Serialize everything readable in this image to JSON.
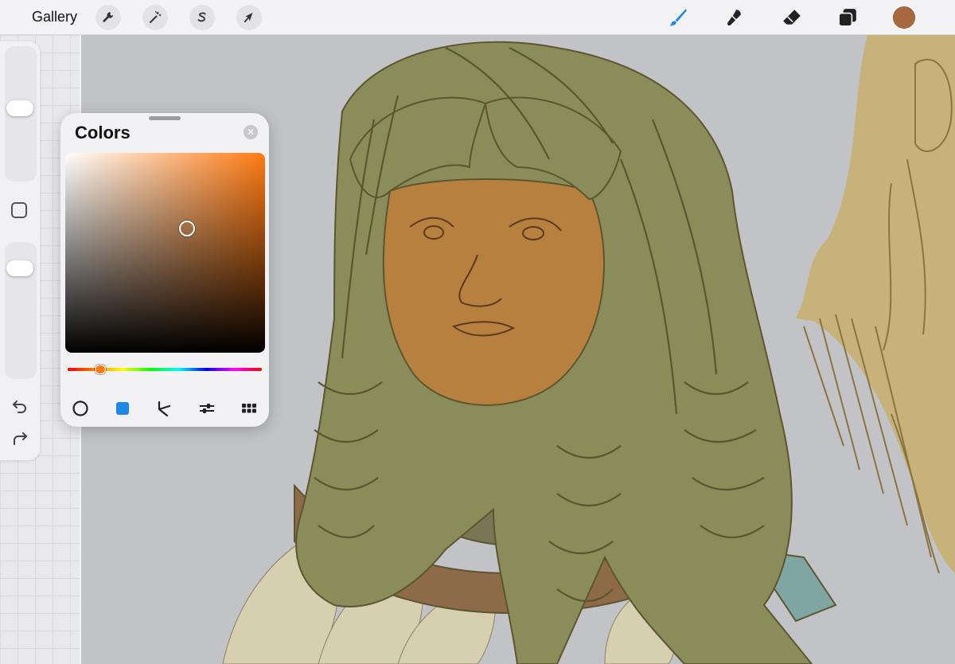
{
  "topbar": {
    "gallery_label": "Gallery",
    "left_tools": [
      {
        "name": "actions",
        "icon": "wrench-icon"
      },
      {
        "name": "adjustments",
        "icon": "magic-wand-icon"
      },
      {
        "name": "selection",
        "icon": "selection-s-icon"
      },
      {
        "name": "transform",
        "icon": "arrow-cursor-icon"
      }
    ],
    "right_tools": [
      {
        "name": "brush",
        "icon": "brush-icon",
        "active": true
      },
      {
        "name": "smudge",
        "icon": "smudge-icon",
        "active": false
      },
      {
        "name": "eraser",
        "icon": "eraser-icon",
        "active": false
      },
      {
        "name": "layers",
        "icon": "layers-icon",
        "active": false
      }
    ],
    "current_color": "#a8693f",
    "active_tool_color": "#1e88e5"
  },
  "sidebar": {
    "brush_size": 0.55,
    "brush_opacity": 0.85,
    "icons": [
      "modifier-square-icon",
      "undo-icon",
      "redo-icon"
    ]
  },
  "colors_panel": {
    "title": "Colors",
    "hue_hex": "#ff7a12",
    "saturation": 0.61,
    "brightness": 0.62,
    "hue_position": 0.17,
    "modes": [
      {
        "name": "disc",
        "icon": "disc-mode-icon",
        "active": false
      },
      {
        "name": "classic",
        "icon": "classic-mode-icon",
        "active": true
      },
      {
        "name": "harmony",
        "icon": "harmony-mode-icon",
        "active": false
      },
      {
        "name": "value",
        "icon": "value-sliders-icon",
        "active": false
      },
      {
        "name": "palettes",
        "icon": "palettes-grid-icon",
        "active": false
      }
    ]
  },
  "colors": {
    "skin": "#b8803f",
    "hair": "#8a8c5a",
    "hair_line": "#5c5630",
    "feathers": "#d6d0b0",
    "collar": "#8d6a48",
    "scarf": "#7fa6a2",
    "sketch": "#b89d63"
  }
}
